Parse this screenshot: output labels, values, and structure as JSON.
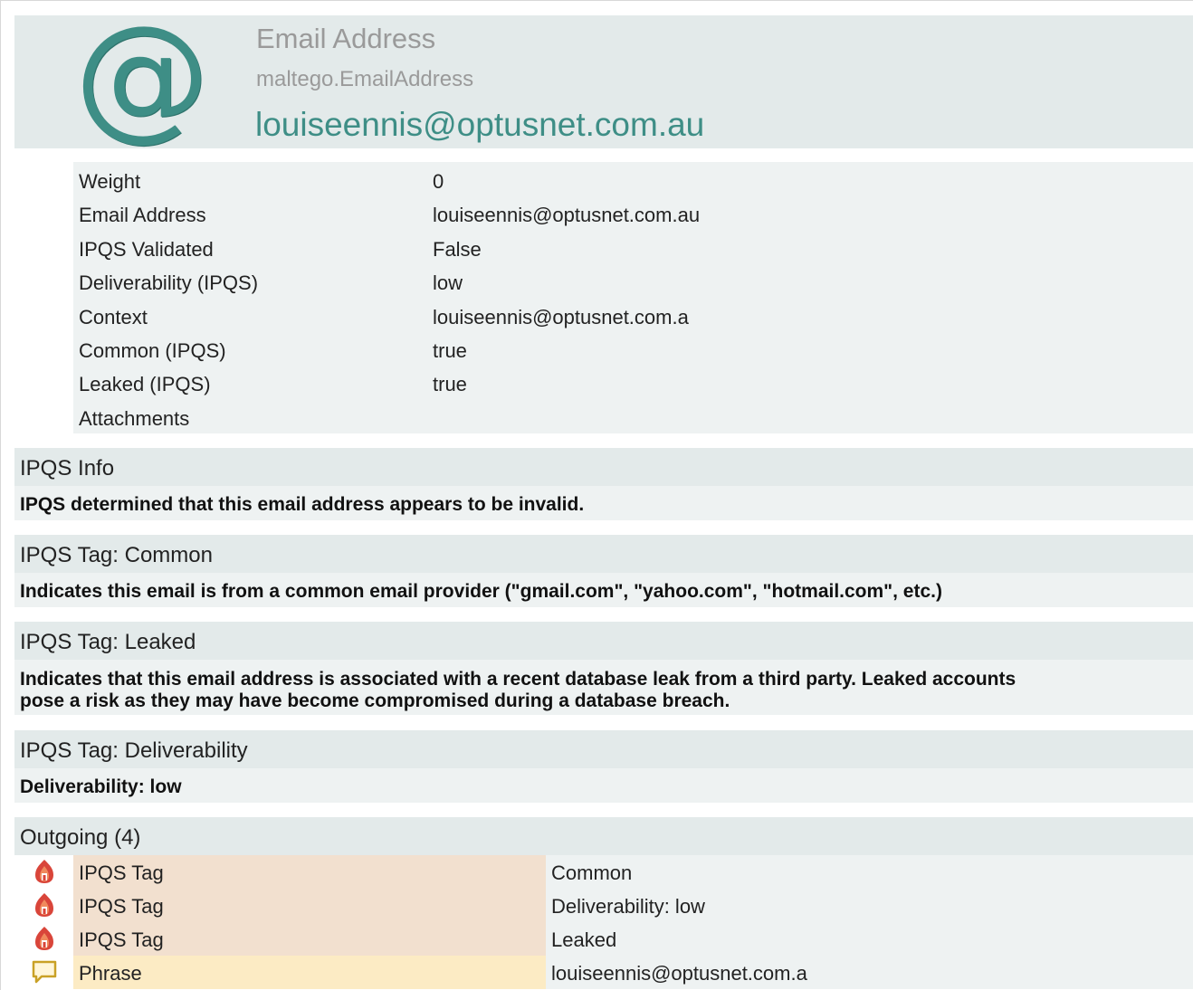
{
  "entity": {
    "icon": "at-sign-icon",
    "icon_glyph": "@",
    "type_display": "Email Address",
    "type_id": "maltego.EmailAddress",
    "value": "louiseennis@optusnet.com.au",
    "accent_color": "#3e8e86"
  },
  "properties": [
    {
      "key": "Weight",
      "value": "0"
    },
    {
      "key": "Email Address",
      "value": "louiseennis@optusnet.com.au"
    },
    {
      "key": "IPQS Validated",
      "value": "False"
    },
    {
      "key": "Deliverability (IPQS)",
      "value": "low"
    },
    {
      "key": "Context",
      "value": "louiseennis@optusnet.com.a"
    },
    {
      "key": "Common (IPQS)",
      "value": "true"
    },
    {
      "key": "Leaked (IPQS)",
      "value": "true"
    },
    {
      "key": "Attachments",
      "value": ""
    }
  ],
  "sections": [
    {
      "title": "IPQS Info",
      "body": "IPQS determined that this email address appears to be invalid."
    },
    {
      "title": "IPQS Tag: Common",
      "body": "Indicates this email is from a common email provider (\"gmail.com\", \"yahoo.com\", \"hotmail.com\", etc.)"
    },
    {
      "title": "IPQS Tag: Leaked",
      "body_lines": [
        "Indicates that this email address is associated with a recent database leak from a third party. Leaked accounts",
        "pose a risk as they may have become compromised during a database breach."
      ]
    },
    {
      "title": "IPQS Tag: Deliverability",
      "body": "Deliverability: low"
    }
  ],
  "outgoing": {
    "title": "Outgoing (4)",
    "items": [
      {
        "icon": "ipqs-tag-icon",
        "type": "IPQS Tag",
        "value": "Common",
        "type_bg": "#f2e0cf"
      },
      {
        "icon": "ipqs-tag-icon",
        "type": "IPQS Tag",
        "value": "Deliverability: low",
        "type_bg": "#f2e0cf"
      },
      {
        "icon": "ipqs-tag-icon",
        "type": "IPQS Tag",
        "value": "Leaked",
        "type_bg": "#f2e0cf"
      },
      {
        "icon": "phrase-speech-bubble-icon",
        "type": "Phrase",
        "value": "louiseennis@optusnet.com.a",
        "type_bg": "#fcebc4"
      }
    ]
  }
}
